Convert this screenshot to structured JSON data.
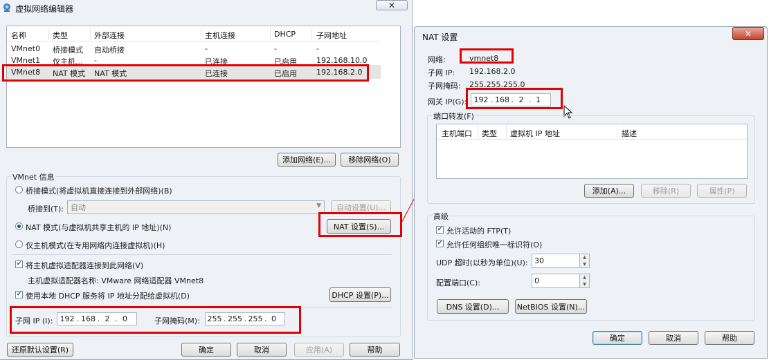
{
  "main_window": {
    "title": "虚拟网络编辑器",
    "network_table": {
      "headers": [
        "名称",
        "类型",
        "外部连接",
        "主机连接",
        "DHCP",
        "子网地址"
      ],
      "rows": [
        [
          "VMnet0",
          "桥接模式",
          "自动桥接",
          "-",
          "-",
          "-"
        ],
        [
          "VMnet1",
          "仅主机...",
          "-",
          "已连接",
          "已启用",
          "192.168.10.0"
        ],
        [
          "VMnet8",
          "NAT 模式",
          "NAT 模式",
          "已连接",
          "已启用",
          "192.168.2.0"
        ]
      ]
    },
    "add_network_button": "添加网络(E)...",
    "remove_network_button": "移除网络(O)",
    "vmnet_info_title": "VMnet 信息",
    "bridge_mode_label": "桥接模式(将虚拟机直接连接到外部网络)(B)",
    "bridged_to_label": "桥接到(T):",
    "bridged_to_value": "自动",
    "auto_settings_button": "自动设置(U)...",
    "nat_mode_label": "NAT 模式(与虚拟机共享主机的 IP 地址)(N)",
    "nat_settings_button": "NAT 设置(S)...",
    "host_only_label": "仅主机模式(在专用网络内连接虚拟机)(H)",
    "connect_adapter_label": "将主机虚拟适配器连接到此网络(V)",
    "adapter_name_label": "主机虚拟适配器名称: VMware 网络适配器 VMnet8",
    "use_dhcp_label": "使用本地 DHCP 服务将 IP 地址分配给虚拟机(D)",
    "dhcp_settings_button": "DHCP 设置(P)...",
    "subnet_ip_label": "子网 IP (I):",
    "subnet_ip": [
      "192",
      "168",
      "2",
      "0"
    ],
    "subnet_mask_label": "子网掩码(M):",
    "subnet_mask": [
      "255",
      "255",
      "255",
      "0"
    ],
    "restore_defaults_button": "还原默认设置(R)",
    "ok_button": "确定",
    "cancel_button": "取消",
    "apply_button": "应用(A)",
    "help_button": "帮助"
  },
  "nat_dialog": {
    "title": "NAT 设置",
    "network_label": "网络:",
    "network_value": "vmnet8",
    "subnet_ip_label": "子网 IP:",
    "subnet_ip_value": "192.168.2.0",
    "subnet_mask_label": "子网掩码:",
    "subnet_mask_value": "255.255.255.0",
    "gateway_label": "网关 IP(G):",
    "gateway_ip": [
      "192",
      "168",
      "2",
      "1"
    ],
    "port_forward_title": "端口转发(F)",
    "pf_headers": [
      "主机端口",
      "类型",
      "虚拟机 IP 地址",
      "描述"
    ],
    "add_button": "添加(A)...",
    "remove_button": "移除(R)",
    "properties_button": "属性(P)",
    "advanced_title": "高级",
    "allow_ftp_label": "允许活动的 FTP(T)",
    "allow_oui_label": "允许任何组织唯一标识符(O)",
    "udp_timeout_label": "UDP 超时(以秒为单位)(U):",
    "udp_timeout_value": "30",
    "config_port_label": "配置端口(C):",
    "config_port_value": "0",
    "dns_settings_button": "DNS 设置(D)...",
    "netbios_settings_button": "NetBIOS 设置(N)...",
    "ok_button": "确定",
    "cancel_button": "取消",
    "help_button": "帮助"
  },
  "colors": {
    "highlight_red": "#e30000",
    "selected_row": "#e5e5e5",
    "window_bg": "#eef2f7"
  }
}
